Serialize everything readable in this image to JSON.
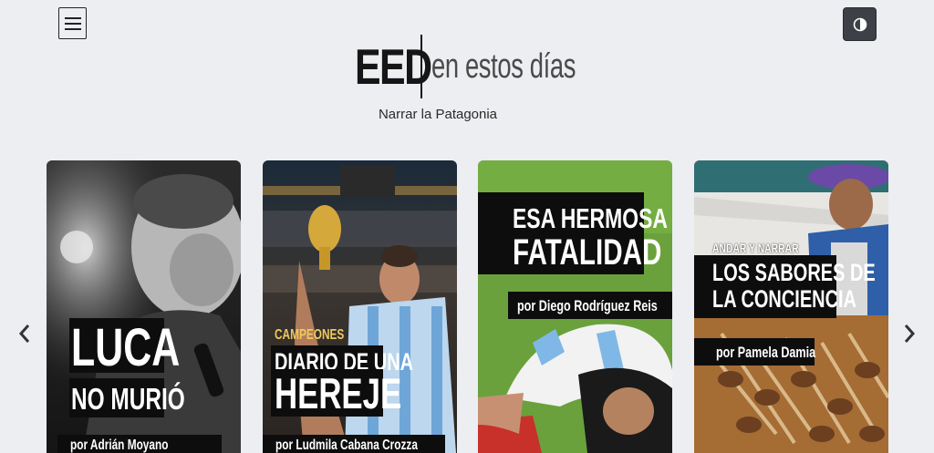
{
  "header": {
    "logo_mark": "EED",
    "logo_tagline": "en estos días",
    "subtitle": "Narrar la Patagonia"
  },
  "icons": {
    "menu": "hamburger-icon",
    "theme": "contrast-icon",
    "prev": "chevron-left-icon",
    "next": "chevron-right-icon"
  },
  "colors": {
    "page_bg": "#eceef1",
    "caption_bg": "#0d0d0d",
    "kicker_gold": "#f1c85e",
    "theme_button": "#3d4047"
  },
  "cards": [
    {
      "title_line1": "LUCA",
      "title_line2": "NO MURIÓ",
      "author": "por Adrián Moyano"
    },
    {
      "kicker": "CAMPEONES",
      "title_line1": "DIARIO DE UNA",
      "title_line2": "HEREJE",
      "author": "por Ludmila Cabana Crozza"
    },
    {
      "title_line1": "ESA HERMOSA",
      "title_line2": "FATALIDAD",
      "author": "por Diego Rodríguez Reis"
    },
    {
      "kicker": "ANDAR Y NARRAR",
      "title_line1": "LOS SABORES DE",
      "title_line2": "LA CONCIENCIA",
      "author": "por Pamela Damia"
    }
  ]
}
